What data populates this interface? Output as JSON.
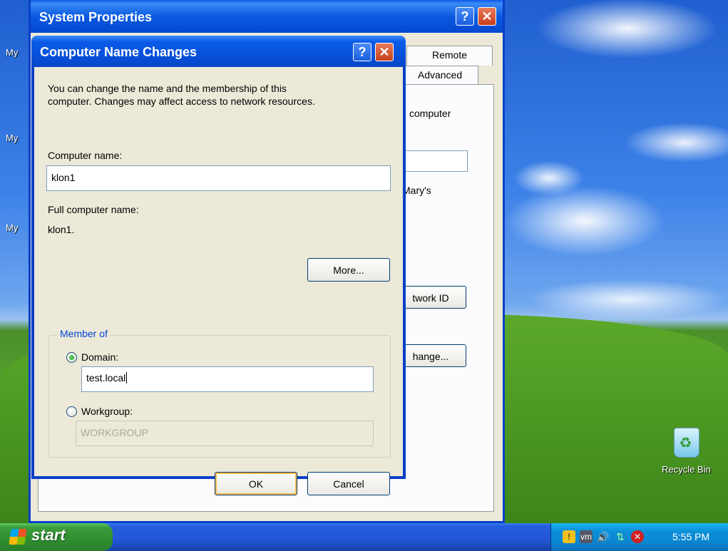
{
  "desktop": {
    "icon_labels": [
      "My",
      "My",
      "My"
    ],
    "recycle_bin_label": "Recycle Bin"
  },
  "system_properties": {
    "title": "System Properties",
    "tabs": {
      "remote": "Remote",
      "advanced": "Advanced"
    },
    "partial_texts": {
      "computer": "computer",
      "marys": "Mary's",
      "network_id": "twork ID",
      "change": "hange..."
    }
  },
  "dialog": {
    "title": "Computer Name Changes",
    "intro_line1": "You can change the name and the membership of this",
    "intro_line2": "computer. Changes may affect access to network resources.",
    "computer_name_label": "Computer name:",
    "computer_name_value": "klon1",
    "full_name_label": "Full computer name:",
    "full_name_value": "klon1.",
    "more_button": "More...",
    "member_of_label": "Member of",
    "domain_label": "Domain:",
    "domain_value": "test.local",
    "domain_selected": true,
    "workgroup_label": "Workgroup:",
    "workgroup_value": "WORKGROUP",
    "ok_button": "OK",
    "cancel_button": "Cancel"
  },
  "title_buttons": {
    "help": "?",
    "close": "✕"
  },
  "taskbar": {
    "start_label": "start",
    "clock": "5:55 PM",
    "tray_icons": [
      "shield-alert-icon",
      "vmware-icon",
      "volume-icon",
      "network-icon",
      "security-center-icon"
    ]
  },
  "colors": {
    "xp_blue": "#0a3fc8",
    "start_green": "#3b9d3b",
    "dialog_face": "#ece9d8",
    "group_label": "#0046d5"
  }
}
